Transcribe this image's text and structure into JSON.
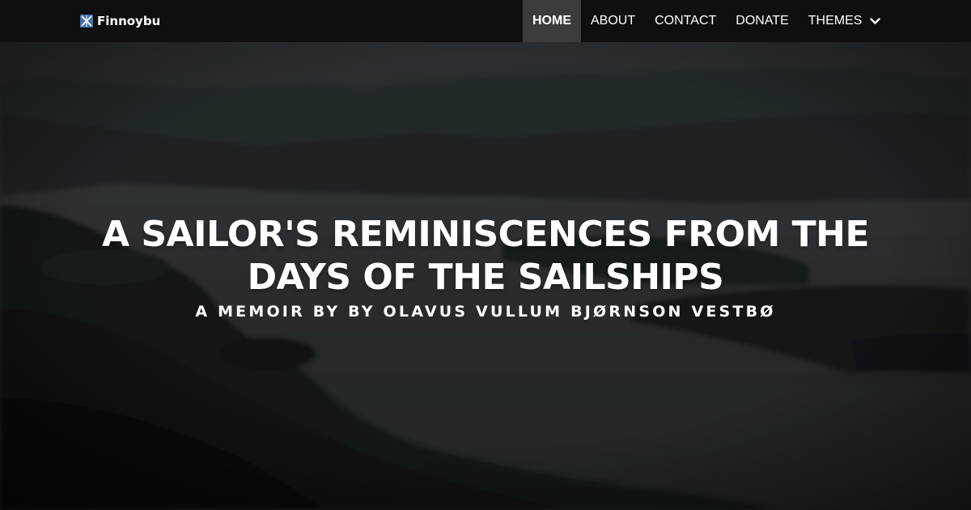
{
  "brand": {
    "name": "Finnoybu",
    "logo_icon": "flag-logo-icon"
  },
  "nav": {
    "items": [
      {
        "label": "HOME",
        "active": true
      },
      {
        "label": "ABOUT",
        "active": false
      },
      {
        "label": "CONTACT",
        "active": false
      },
      {
        "label": "DONATE",
        "active": false
      },
      {
        "label": "THEMES",
        "active": false,
        "dropdown_icon": "chevron-down-icon"
      }
    ]
  },
  "hero": {
    "title_line1": "A SAILOR'S REMINISCENCES FROM THE",
    "title_line2": "DAYS OF THE SAILSHIPS",
    "subtitle": "A MEMOIR BY BY OLAVUS VULLUM BJØRNSON VESTBØ",
    "background": "fjord-landscape-photo"
  },
  "colors": {
    "navbar_bg": "#0f0f0f",
    "nav_active_bg": "#3c3c3c",
    "text": "#ffffff"
  }
}
